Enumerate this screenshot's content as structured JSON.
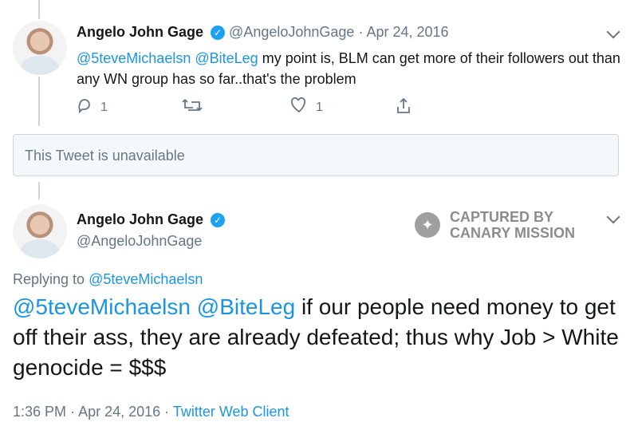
{
  "tweet1": {
    "name": "Angelo John Gage",
    "handle": "@AngeloJohnGage",
    "date": "Apr 24, 2016",
    "mentions": [
      "@5teveMichaelsn",
      "@BiteLeg"
    ],
    "text": "my point is, BLM can get more of their followers out than any WN group has so far..that's the problem",
    "actions": {
      "reply_count": "1",
      "like_count": "1"
    }
  },
  "unavailable_text": "This Tweet is unavailable",
  "tweet2": {
    "name": "Angelo John Gage",
    "handle": "@AngeloJohnGage",
    "reply_prefix": "Replying to",
    "reply_to": "@5teveMichaelsn",
    "mentions": [
      "@5teveMichaelsn",
      "@BiteLeg"
    ],
    "text": "if our people need money to get off their ass, they are already defeated; thus why Job > White genocide = $$$",
    "time": "1:36 PM",
    "date": "Apr 24, 2016",
    "source": "Twitter Web Client"
  },
  "watermark": {
    "line1": "CAPTURED BY",
    "line2": "CANARY MISSION"
  },
  "icons": [
    "avatar",
    "verified-icon",
    "reply-icon",
    "retweet-icon",
    "like-icon",
    "share-icon",
    "chevron-down-icon",
    "canary-icon"
  ]
}
